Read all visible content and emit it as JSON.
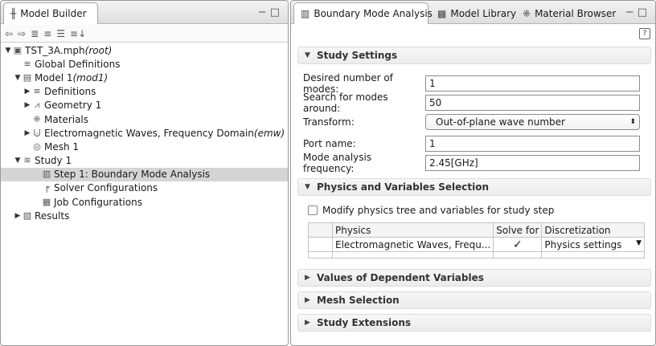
{
  "model_builder": {
    "tab_label": "Model Builder",
    "toolbar_icons": [
      "back-arrow-icon",
      "forward-arrow-icon",
      "collapse-all-icon",
      "expand-icon",
      "show-more-icon",
      "sort-icon"
    ],
    "tree": [
      {
        "text": "TST_3A.mph ",
        "em": "(root)",
        "icon": "root-file-icon"
      },
      {
        "text": "Global Definitions",
        "em": "",
        "icon": "global-definitions-icon"
      },
      {
        "text": "Model 1 ",
        "em": "(mod1)",
        "icon": "model-icon"
      },
      {
        "text": "Definitions",
        "em": "",
        "icon": "definitions-icon"
      },
      {
        "text": "Geometry 1",
        "em": "",
        "icon": "geometry-icon"
      },
      {
        "text": "Materials",
        "em": "",
        "icon": "materials-icon"
      },
      {
        "text": "Electromagnetic Waves, Frequency Domain ",
        "em": "(emw)",
        "icon": "emw-physics-icon"
      },
      {
        "text": "Mesh 1",
        "em": "",
        "icon": "mesh-icon"
      },
      {
        "text": "Study 1",
        "em": "",
        "icon": "study-icon"
      },
      {
        "text": "Step 1: Boundary Mode Analysis",
        "em": "",
        "icon": "study-step-icon"
      },
      {
        "text": "Solver Configurations",
        "em": "",
        "icon": "solver-configurations-icon"
      },
      {
        "text": "Job Configurations",
        "em": "",
        "icon": "job-configurations-icon"
      },
      {
        "text": "Results",
        "em": "",
        "icon": "results-icon"
      }
    ]
  },
  "tabs": {
    "boundary_mode": "Boundary Mode Analysis",
    "model_library": "Model Library",
    "material_browser": "Material Browser"
  },
  "study_settings": {
    "title": "Study Settings",
    "fields": {
      "num_modes_label": "Desired number of modes:",
      "num_modes_value": "1",
      "search_label": "Search for modes around:",
      "search_value": "50",
      "transform_label": "Transform:",
      "transform_value": "Out-of-plane wave number",
      "port_label": "Port name:",
      "port_value": "1",
      "freq_label": "Mode analysis frequency:",
      "freq_value": "2.45[GHz]"
    }
  },
  "physics_vars": {
    "title": "Physics and Variables Selection",
    "modify_label": "Modify physics tree and variables for study step",
    "modify_checked": false,
    "table": {
      "headers": [
        "Physics",
        "Solve for",
        "Discretization"
      ],
      "rows": [
        {
          "physics": "Electromagnetic Waves, Frequ...",
          "solve": "✓",
          "discretization": "Physics settings"
        }
      ]
    }
  },
  "collapsed_sections": {
    "dependent": "Values of Dependent Variables",
    "mesh": "Mesh Selection",
    "extensions": "Study Extensions"
  }
}
